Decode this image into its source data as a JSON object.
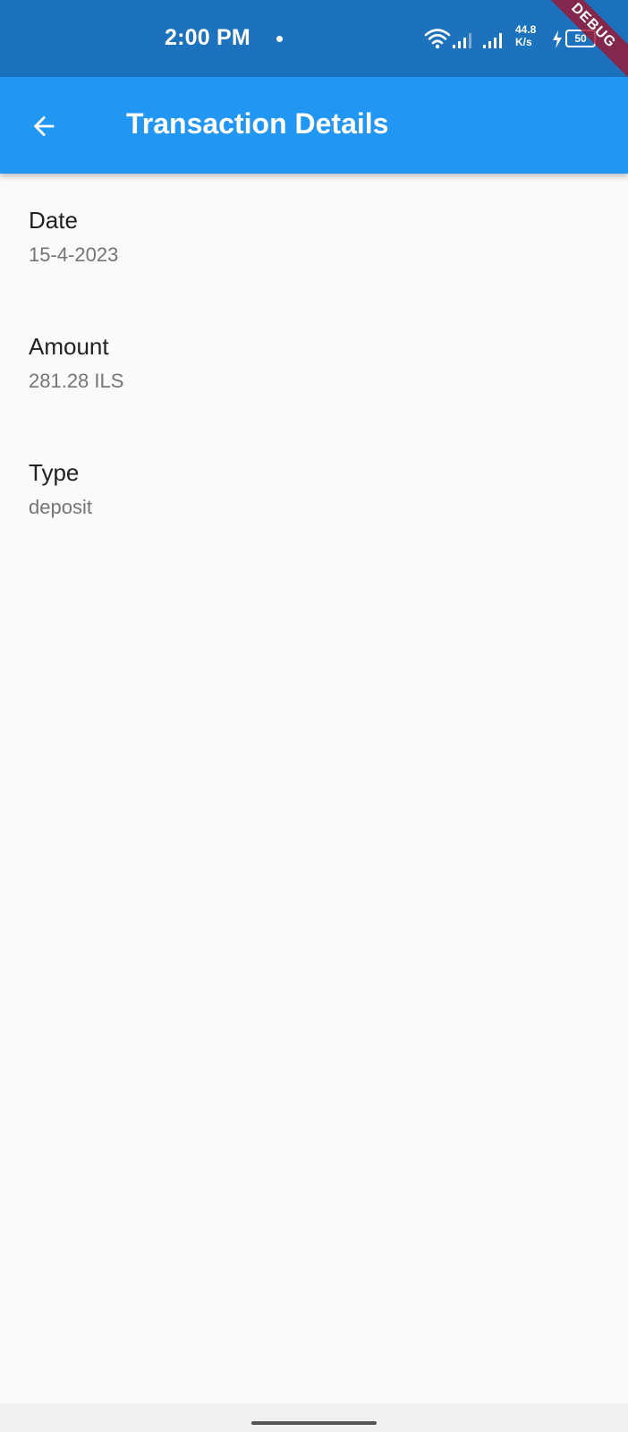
{
  "status_bar": {
    "time": "2:00 PM",
    "net_speed_value": "44.8",
    "net_speed_unit": "K/s",
    "battery": "50",
    "debug_banner": "DEBUG"
  },
  "app_bar": {
    "title": "Transaction Details",
    "back_icon": "arrow-back-icon"
  },
  "details": [
    {
      "label": "Date",
      "value": "15-4-2023"
    },
    {
      "label": "Amount",
      "value": "281.28 ILS"
    },
    {
      "label": "Type",
      "value": "deposit"
    }
  ],
  "colors": {
    "status_bar": "#1c72bd",
    "app_bar": "#2196f3",
    "background": "#fafafa",
    "label_text": "#212121",
    "value_text": "#757575"
  }
}
